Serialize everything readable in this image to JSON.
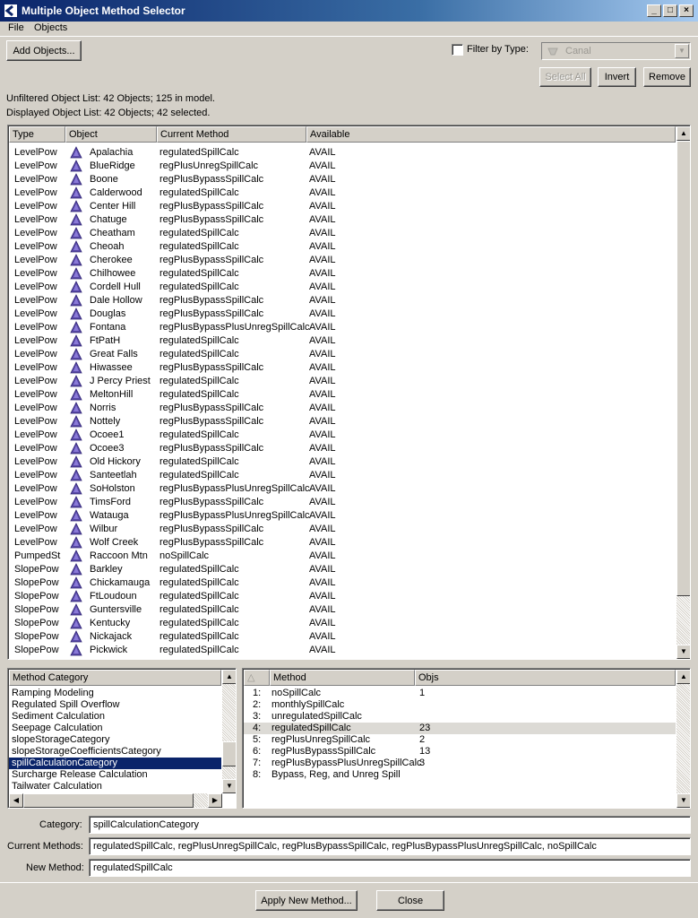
{
  "window": {
    "title": "Multiple Object Method Selector",
    "min": "_",
    "max": "□",
    "close": "×"
  },
  "menu": [
    "File",
    "Objects"
  ],
  "toolbar": {
    "add_objects": "Add Objects...",
    "filter_label": "Filter by Type:",
    "filter_checked": false,
    "filter_value": "Canal",
    "select_all": "Select All",
    "invert": "Invert",
    "remove": "Remove"
  },
  "status": {
    "unfiltered": "Unfiltered Object List:  42 Objects;  125 in model.",
    "displayed": "Displayed Object List:  42 Objects;  42 selected."
  },
  "object_table": {
    "headers": [
      "Type",
      "Object",
      "Current Method",
      "Available"
    ],
    "rows": [
      [
        "LevelPow",
        "Apalachia",
        "regulatedSpillCalc",
        "AVAIL"
      ],
      [
        "LevelPow",
        "BlueRidge",
        "regPlusUnregSpillCalc",
        "AVAIL"
      ],
      [
        "LevelPow",
        "Boone",
        "regPlusBypassSpillCalc",
        "AVAIL"
      ],
      [
        "LevelPow",
        "Calderwood",
        "regulatedSpillCalc",
        "AVAIL"
      ],
      [
        "LevelPow",
        "Center Hill",
        "regPlusBypassSpillCalc",
        "AVAIL"
      ],
      [
        "LevelPow",
        "Chatuge",
        "regPlusBypassSpillCalc",
        "AVAIL"
      ],
      [
        "LevelPow",
        "Cheatham",
        "regulatedSpillCalc",
        "AVAIL"
      ],
      [
        "LevelPow",
        "Cheoah",
        "regulatedSpillCalc",
        "AVAIL"
      ],
      [
        "LevelPow",
        "Cherokee",
        "regPlusBypassSpillCalc",
        "AVAIL"
      ],
      [
        "LevelPow",
        "Chilhowee",
        "regulatedSpillCalc",
        "AVAIL"
      ],
      [
        "LevelPow",
        "Cordell Hull",
        "regulatedSpillCalc",
        "AVAIL"
      ],
      [
        "LevelPow",
        "Dale Hollow",
        "regPlusBypassSpillCalc",
        "AVAIL"
      ],
      [
        "LevelPow",
        "Douglas",
        "regPlusBypassSpillCalc",
        "AVAIL"
      ],
      [
        "LevelPow",
        "Fontana",
        "regPlusBypassPlusUnregSpillCalc",
        "AVAIL"
      ],
      [
        "LevelPow",
        "FtPatH",
        "regulatedSpillCalc",
        "AVAIL"
      ],
      [
        "LevelPow",
        "Great Falls",
        "regulatedSpillCalc",
        "AVAIL"
      ],
      [
        "LevelPow",
        "Hiwassee",
        "regPlusBypassSpillCalc",
        "AVAIL"
      ],
      [
        "LevelPow",
        "J Percy Priest",
        "regulatedSpillCalc",
        "AVAIL"
      ],
      [
        "LevelPow",
        "MeltonHill",
        "regulatedSpillCalc",
        "AVAIL"
      ],
      [
        "LevelPow",
        "Norris",
        "regPlusBypassSpillCalc",
        "AVAIL"
      ],
      [
        "LevelPow",
        "Nottely",
        "regPlusBypassSpillCalc",
        "AVAIL"
      ],
      [
        "LevelPow",
        "Ocoee1",
        "regulatedSpillCalc",
        "AVAIL"
      ],
      [
        "LevelPow",
        "Ocoee3",
        "regPlusBypassSpillCalc",
        "AVAIL"
      ],
      [
        "LevelPow",
        "Old Hickory",
        "regulatedSpillCalc",
        "AVAIL"
      ],
      [
        "LevelPow",
        "Santeetlah",
        "regulatedSpillCalc",
        "AVAIL"
      ],
      [
        "LevelPow",
        "SoHolston",
        "regPlusBypassPlusUnregSpillCalc",
        "AVAIL"
      ],
      [
        "LevelPow",
        "TimsFord",
        "regPlusBypassSpillCalc",
        "AVAIL"
      ],
      [
        "LevelPow",
        "Watauga",
        "regPlusBypassPlusUnregSpillCalc",
        "AVAIL"
      ],
      [
        "LevelPow",
        "Wilbur",
        "regPlusBypassSpillCalc",
        "AVAIL"
      ],
      [
        "LevelPow",
        "Wolf Creek",
        "regPlusBypassSpillCalc",
        "AVAIL"
      ],
      [
        "PumpedSt",
        "Raccoon Mtn",
        "noSpillCalc",
        "AVAIL"
      ],
      [
        "SlopePow",
        "Barkley",
        "regulatedSpillCalc",
        "AVAIL"
      ],
      [
        "SlopePow",
        "Chickamauga",
        "regulatedSpillCalc",
        "AVAIL"
      ],
      [
        "SlopePow",
        "FtLoudoun",
        "regulatedSpillCalc",
        "AVAIL"
      ],
      [
        "SlopePow",
        "Guntersville",
        "regulatedSpillCalc",
        "AVAIL"
      ],
      [
        "SlopePow",
        "Kentucky",
        "regulatedSpillCalc",
        "AVAIL"
      ],
      [
        "SlopePow",
        "Nickajack",
        "regulatedSpillCalc",
        "AVAIL"
      ],
      [
        "SlopePow",
        "Pickwick",
        "regulatedSpillCalc",
        "AVAIL"
      ]
    ]
  },
  "category_list": {
    "header": "Method Category",
    "items": [
      "Ramping Modeling",
      "Regulated Spill Overflow",
      "Sediment Calculation",
      "Seepage Calculation",
      "slopeStorageCategory",
      "slopeStorageCoefficientsCategory",
      "spillCalculationCategory",
      "Surcharge Release Calculation",
      "Tailwater Calculation"
    ],
    "selected_index": 6
  },
  "method_table": {
    "headers": [
      "",
      "Method",
      "Objs"
    ],
    "rows": [
      [
        "1:",
        "noSpillCalc",
        "1"
      ],
      [
        "2:",
        "monthlySpillCalc",
        ""
      ],
      [
        "3:",
        "unregulatedSpillCalc",
        ""
      ],
      [
        "4:",
        "regulatedSpillCalc",
        "23"
      ],
      [
        "5:",
        "regPlusUnregSpillCalc",
        "2"
      ],
      [
        "6:",
        "regPlusBypassSpillCalc",
        "13"
      ],
      [
        "7:",
        "regPlusBypassPlusUnregSpillCalc",
        "3"
      ],
      [
        "8:",
        "Bypass, Reg, and Unreg Spill",
        ""
      ]
    ],
    "highlighted_index": 3
  },
  "form": {
    "category_label": "Category:",
    "category_value": "spillCalculationCategory",
    "current_label": "Current Methods:",
    "current_value": "regulatedSpillCalc, regPlusUnregSpillCalc, regPlusBypassSpillCalc, regPlusBypassPlusUnregSpillCalc, noSpillCalc",
    "new_label": "New Method:",
    "new_value": "regulatedSpillCalc"
  },
  "footer": {
    "apply": "Apply New Method...",
    "close": "Close"
  },
  "colors": {
    "selection": "#0a246a",
    "highlight_row": "#dcdad5",
    "object_icon": "#5a4aa8"
  },
  "icons": {
    "object": "reservoir-triangle-icon",
    "filter_type": "canal-icon"
  }
}
